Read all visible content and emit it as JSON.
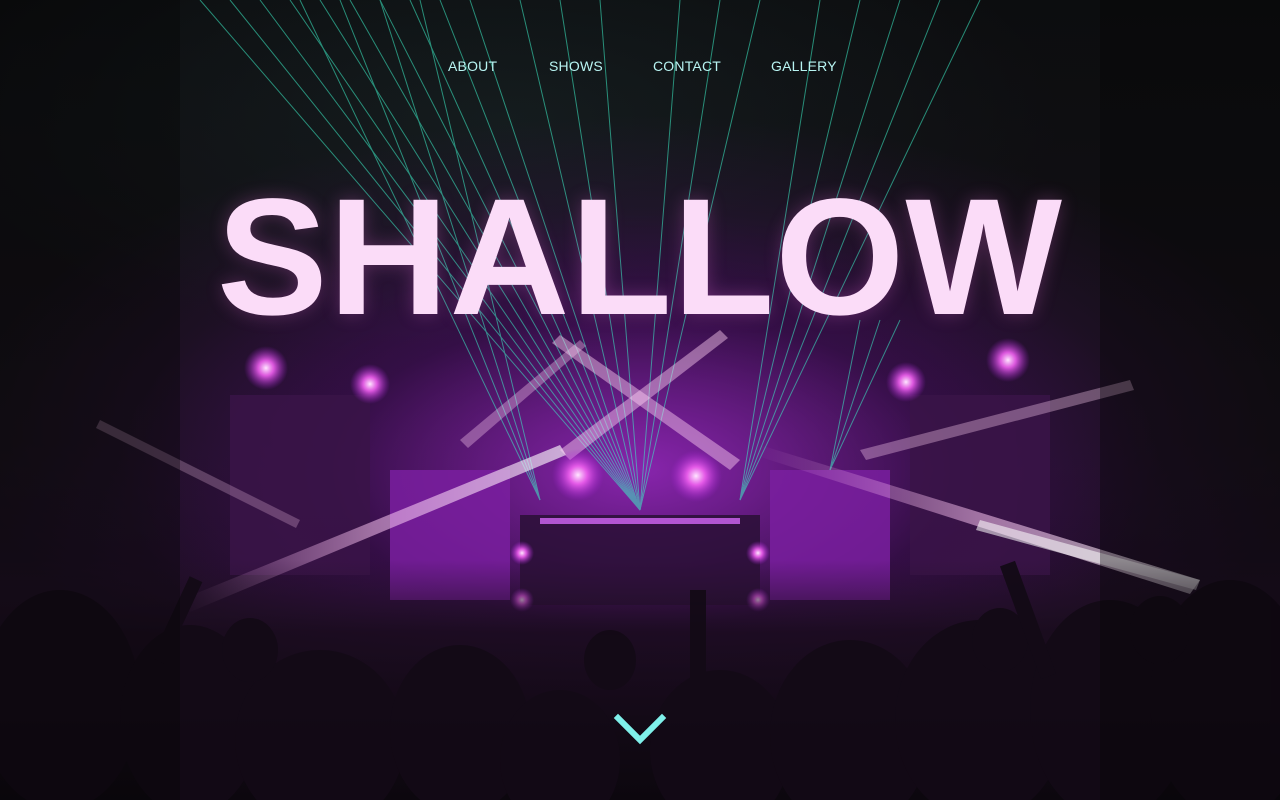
{
  "site": {
    "title": "SHALLOW"
  },
  "nav": {
    "items": [
      {
        "label": "ABOUT"
      },
      {
        "label": "SHOWS"
      },
      {
        "label": "CONTACT"
      },
      {
        "label": "GALLERY"
      }
    ]
  },
  "scroll_indicator": {
    "icon": "chevron-down-icon",
    "color": "#7ff0ea"
  },
  "colors": {
    "nav_text": "#b8f4f2",
    "title_text": "#fbdcf8",
    "laser_green": "#3cf0c8",
    "stage_magenta": "#c040e0"
  }
}
